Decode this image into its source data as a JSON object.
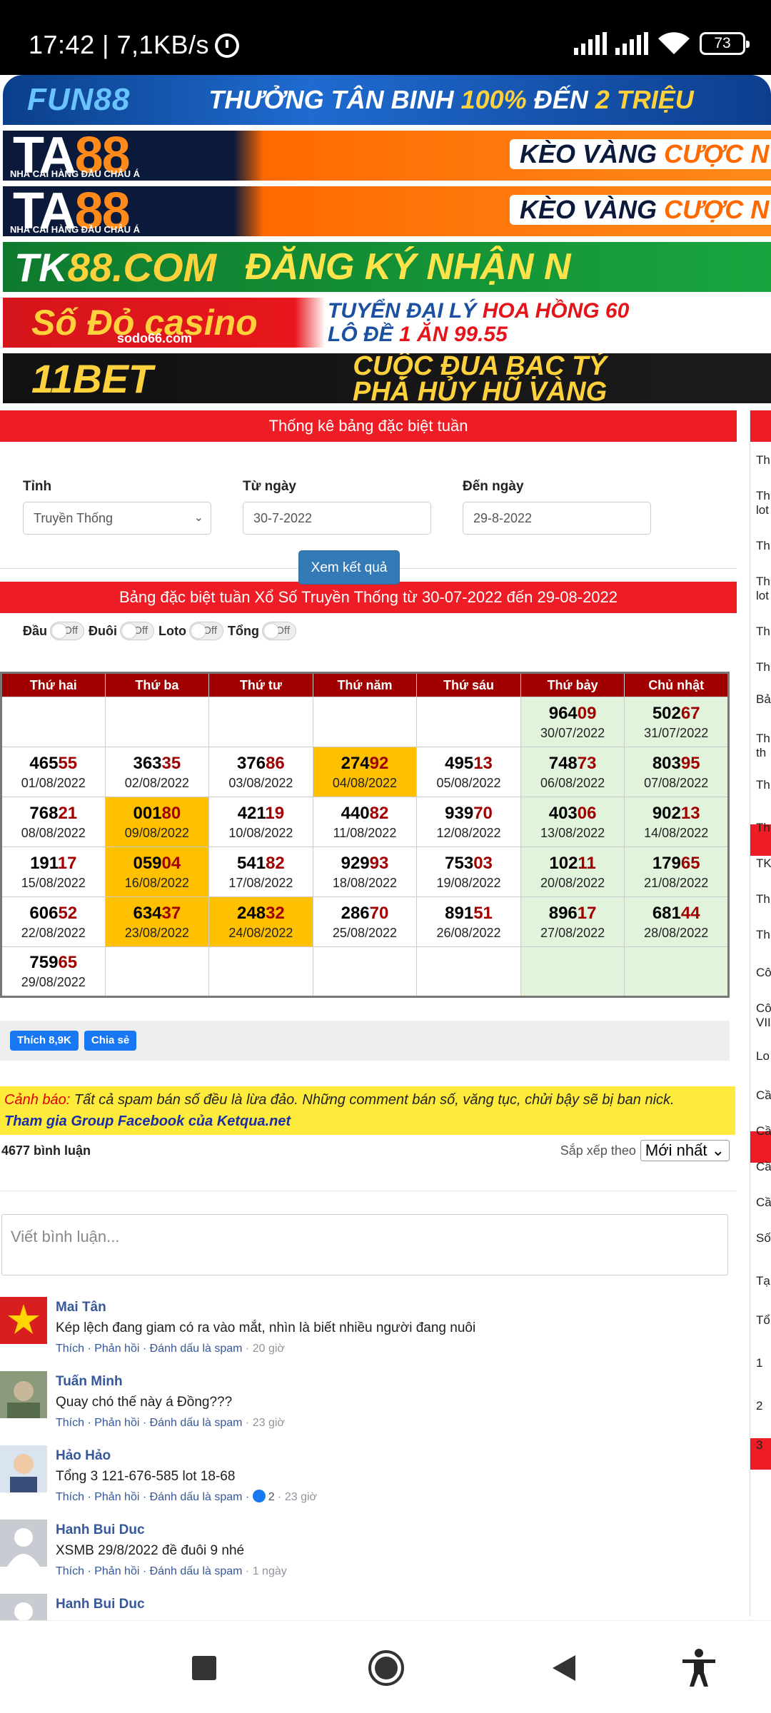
{
  "status": {
    "time": "17:42 | 7,1KB/s",
    "battery": "73"
  },
  "banners": {
    "fun88": {
      "logo": "FUN88",
      "text_a": "THƯỞNG TÂN BINH ",
      "text_b": "100%",
      "text_c": " ĐẾN ",
      "text_d": "2 TRIỆU"
    },
    "ta88": {
      "logo_a": "TA",
      "logo_b": "88",
      "sub": "NHÀ CÁI HÀNG ĐẦU CHÂU Á",
      "text_a": "KÈO VÀNG ",
      "text_b": "CƯỢC N"
    },
    "tk88": {
      "logo_a": "TK",
      "logo_b": "88.COM",
      "text": "ĐĂNG KÝ NHẬN N"
    },
    "sodo": {
      "logo": "Số Đỏ casino",
      "small": "sodo66.com",
      "line1_a": "TUYỂN ĐẠI LÝ  ",
      "line1_b": "HOA HỒNG 60",
      "line2_a": "LÔ ĐỀ  ",
      "line2_b": "1 ĂN 99.55"
    },
    "bet11": {
      "logo": "11BET",
      "line1": "CUỘC ĐUA BẠC TỶ",
      "line2": "PHÁ HỦY HŨ VÀNG"
    }
  },
  "form": {
    "title": "Thống kê bảng đặc biệt tuần",
    "province_label": "Tỉnh",
    "province_value": "Truyền Thống",
    "from_label": "Từ ngày",
    "from_value": "30-7-2022",
    "to_label": "Đến ngày",
    "to_value": "29-8-2022",
    "submit": "Xem kết quả"
  },
  "table_panel": {
    "title": "Bảng đặc biệt tuần Xổ Số Truyền Thống từ 30-07-2022 đến 29-08-2022",
    "toggles": [
      {
        "label": "Đầu",
        "state": "Off"
      },
      {
        "label": "Đuôi",
        "state": "Off"
      },
      {
        "label": "Loto",
        "state": "Off"
      },
      {
        "label": "Tổng",
        "state": "Off"
      }
    ],
    "headers": [
      "Thứ hai",
      "Thứ ba",
      "Thứ tư",
      "Thứ năm",
      "Thứ sáu",
      "Thứ bảy",
      "Chủ nhật"
    ],
    "rows": [
      [
        null,
        null,
        null,
        null,
        null,
        {
          "h": "964",
          "t": "09",
          "d": "30/07/2022"
        },
        {
          "h": "502",
          "t": "67",
          "d": "31/07/2022"
        }
      ],
      [
        {
          "h": "465",
          "t": "55",
          "d": "01/08/2022"
        },
        {
          "h": "363",
          "t": "35",
          "d": "02/08/2022"
        },
        {
          "h": "376",
          "t": "86",
          "d": "03/08/2022"
        },
        {
          "h": "274",
          "t": "92",
          "d": "04/08/2022",
          "hl": true
        },
        {
          "h": "495",
          "t": "13",
          "d": "05/08/2022"
        },
        {
          "h": "748",
          "t": "73",
          "d": "06/08/2022"
        },
        {
          "h": "803",
          "t": "95",
          "d": "07/08/2022"
        }
      ],
      [
        {
          "h": "768",
          "t": "21",
          "d": "08/08/2022"
        },
        {
          "h": "001",
          "t": "80",
          "d": "09/08/2022",
          "hl": true
        },
        {
          "h": "421",
          "t": "19",
          "d": "10/08/2022"
        },
        {
          "h": "440",
          "t": "82",
          "d": "11/08/2022"
        },
        {
          "h": "939",
          "t": "70",
          "d": "12/08/2022"
        },
        {
          "h": "403",
          "t": "06",
          "d": "13/08/2022"
        },
        {
          "h": "902",
          "t": "13",
          "d": "14/08/2022"
        }
      ],
      [
        {
          "h": "191",
          "t": "17",
          "d": "15/08/2022"
        },
        {
          "h": "059",
          "t": "04",
          "d": "16/08/2022",
          "hl": true
        },
        {
          "h": "541",
          "t": "82",
          "d": "17/08/2022"
        },
        {
          "h": "929",
          "t": "93",
          "d": "18/08/2022"
        },
        {
          "h": "753",
          "t": "03",
          "d": "19/08/2022"
        },
        {
          "h": "102",
          "t": "11",
          "d": "20/08/2022"
        },
        {
          "h": "179",
          "t": "65",
          "d": "21/08/2022"
        }
      ],
      [
        {
          "h": "606",
          "t": "52",
          "d": "22/08/2022"
        },
        {
          "h": "634",
          "t": "37",
          "d": "23/08/2022",
          "hl": true
        },
        {
          "h": "248",
          "t": "32",
          "d": "24/08/2022",
          "hl": true
        },
        {
          "h": "286",
          "t": "70",
          "d": "25/08/2022"
        },
        {
          "h": "891",
          "t": "51",
          "d": "26/08/2022"
        },
        {
          "h": "896",
          "t": "17",
          "d": "27/08/2022"
        },
        {
          "h": "681",
          "t": "44",
          "d": "28/08/2022"
        }
      ],
      [
        {
          "h": "759",
          "t": "65",
          "d": "29/08/2022"
        },
        null,
        null,
        null,
        null,
        null,
        null
      ]
    ]
  },
  "social": {
    "like": "Thích 8,9K",
    "share": "Chia sẻ"
  },
  "warning": {
    "label": "Cảnh báo:",
    "text": " Tất cả spam bán số đều là lừa đảo. Những comment bán số, văng tục, chửi bậy sẽ bị ban nick.",
    "group": "Tham gia Group Facebook của Ketqua.net"
  },
  "comments_header": {
    "count": "4677 bình luận",
    "sort_label": "Sắp xếp theo",
    "sort_value": "Mới nhất"
  },
  "comment_box": {
    "placeholder": "Viết bình luận..."
  },
  "comments": [
    {
      "name": "Mai Tân",
      "text": "Kép lệch đang giam có ra vào mắt, nhìn là biết nhiều người đang nuôi",
      "actions": "Thích · Phản hồi · Đánh dấu là spam",
      "likes": "",
      "time": " · 20 giờ"
    },
    {
      "name": "Tuấn Minh",
      "text": "Quay chó thế này á Đồng???",
      "actions": "Thích · Phản hồi · Đánh dấu là spam",
      "likes": "",
      "time": " · 23 giờ"
    },
    {
      "name": "Hảo Hảo",
      "text": "Tổng 3 121-676-585 lot 18-68",
      "actions": "Thích · Phản hồi · Đánh dấu là spam · ",
      "likes": "2",
      "time": " · 23 giờ"
    },
    {
      "name": "Hanh Bui Duc",
      "text": "XSMB 29/8/2022 đề đuôi 9 nhé",
      "actions": "Thích · Phản hồi · Đánh dấu là spam",
      "likes": "",
      "time": " · 1 ngày"
    },
    {
      "name": "Hanh Bui Duc",
      "text": "",
      "actions": "",
      "likes": "",
      "time": ""
    }
  ],
  "sidebar_peek": [
    "Th",
    "Th",
    "lot",
    "Th",
    "Th",
    "lot",
    "Th",
    "Th",
    "Bả",
    "Th",
    "th",
    "Th",
    "Th",
    "TK",
    "Th",
    "Th",
    "Cô",
    "Cô",
    "VII",
    "Lo",
    "Cầ",
    "Cầ",
    "Cầ",
    "Cầ",
    "Số",
    "Tạ",
    "Tổ",
    "1",
    "2",
    "3"
  ],
  "colors": {
    "header_red": "#ee1c25",
    "table_head": "#a10000",
    "weekend": "#e2f3dc",
    "highlight": "#ffc000",
    "primary": "#337ab7"
  }
}
